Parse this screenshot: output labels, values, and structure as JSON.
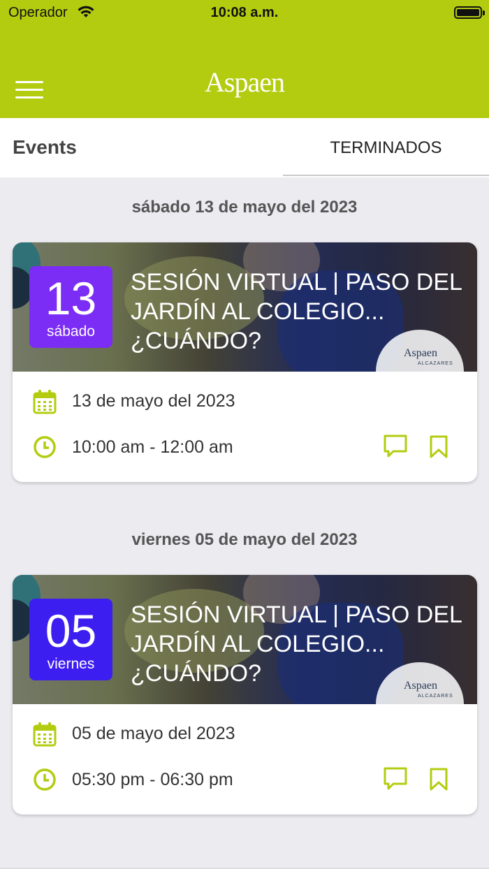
{
  "status_bar": {
    "carrier": "Operador",
    "time": "10:08 a.m."
  },
  "header": {
    "logo": "Aspaen"
  },
  "tabs": {
    "title": "Events",
    "active_tab": "TERMINADOS"
  },
  "colors": {
    "brand_green": "#b3cc10",
    "date_box_1": "#7b2cf5",
    "date_box_2": "#3c1ff0"
  },
  "events": [
    {
      "date_header": "sábado 13 de mayo del 2023",
      "day_number": "13",
      "weekday": "sábado",
      "title": "SESIÓN VIRTUAL | PASO DEL JARDÍN AL COLEGIO... ¿CUÁNDO?",
      "date_text": "13 de mayo del 2023",
      "time_text": "10:00 am - 12:00 am",
      "image_badge": "Aspaen",
      "image_badge_sub": "ALCAZARES"
    },
    {
      "date_header": "viernes 05 de mayo del 2023",
      "day_number": "05",
      "weekday": "viernes",
      "title": "SESIÓN VIRTUAL | PASO DEL JARDÍN AL COLEGIO... ¿CUÁNDO?",
      "date_text": "05 de mayo del 2023",
      "time_text": "05:30 pm - 06:30 pm",
      "image_badge": "Aspaen",
      "image_badge_sub": "ALCAZARES"
    }
  ],
  "icons": {
    "menu": "hamburger-menu-icon",
    "calendar": "calendar-icon",
    "clock": "clock-icon",
    "comment": "comment-icon",
    "bookmark": "bookmark-icon",
    "wifi": "wifi-icon",
    "battery": "battery-icon"
  }
}
